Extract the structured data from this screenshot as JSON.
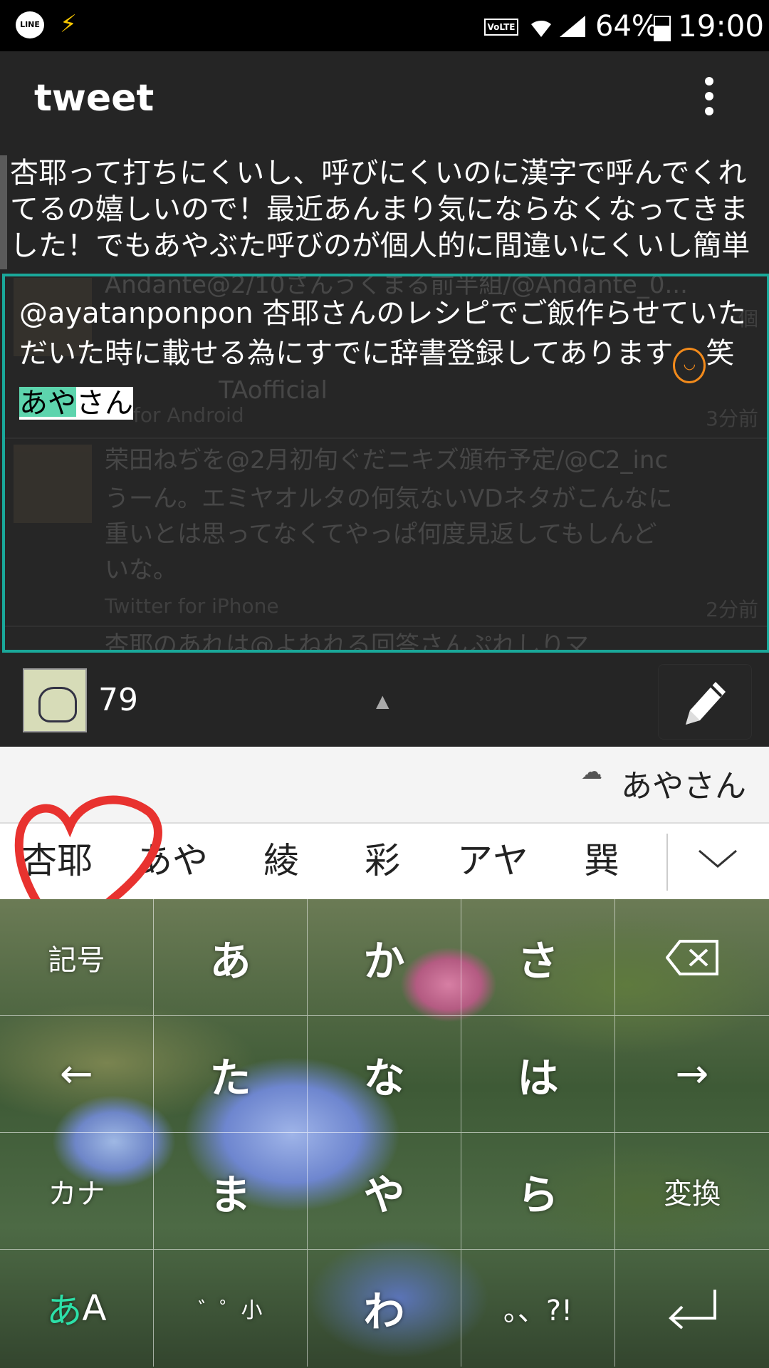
{
  "status_bar": {
    "line_label": "LINE",
    "volte": "VoLTE",
    "battery": "64%",
    "battery_level": 0.64,
    "time": "19:00"
  },
  "app_bar": {
    "title": "tweet"
  },
  "reply_preview": {
    "text": "杏耶って打ちにくいし、呼びにくいのに漢字で呼んでくれてるの嬉しいので！最近あんまり気にならなくなってきました！でもあやぶた呼びのが個人的に間違いにくいし簡単"
  },
  "compose": {
    "text": "@ayatanponpon 杏耶さんのレシピでご飯作らせていただいた時に載せる為にすでに辞書登録してあります",
    "after_emoji": "笑",
    "composing_highlight": "あや",
    "composing_rest": "さん"
  },
  "timeline_ghost": {
    "row1": "Andante@2/10さんうくまる前半組/@Andante_0...",
    "row1b": "個",
    "row2": "TAofficial",
    "row3": "for Android",
    "row3_time": "3分前",
    "row4": "荣田ねぢを@2月初旬ぐだニキズ頒布予定/@C2_inc",
    "row5": "うーん。エミヤオルタの何気ないVDネタがこんなに",
    "row6": "重いとは思ってなくてやっぱ何度見返してもしんど",
    "row7": "いな。",
    "row8": "Twitter for iPhone",
    "row8_time": "2分前",
    "row9": "杏耶のあれは@よねれる回答さんぷれしりマ..."
  },
  "bottom_bar": {
    "char_count": "79"
  },
  "keyboard": {
    "reading": "あやさん",
    "candidates": [
      "杏耶",
      "あや",
      "綾",
      "彩",
      "アヤ",
      "巽"
    ],
    "keys": {
      "kigou": "記号",
      "a": "あ",
      "ka": "か",
      "sa": "さ",
      "left": "←",
      "ta": "た",
      "na": "な",
      "ha": "は",
      "right": "→",
      "kana": "カナ",
      "ma": "ま",
      "ya": "や",
      "ra": "ら",
      "henkan": "変換",
      "mode_a": "あ",
      "mode_A": "A",
      "dakuten": "゛゜小",
      "wa": "わ",
      "punct": "。、?!",
      "enter": "↵"
    }
  },
  "colors": {
    "accent": "#1aa89a",
    "composing": "#5dd4ad",
    "heart": "#e8322f"
  }
}
